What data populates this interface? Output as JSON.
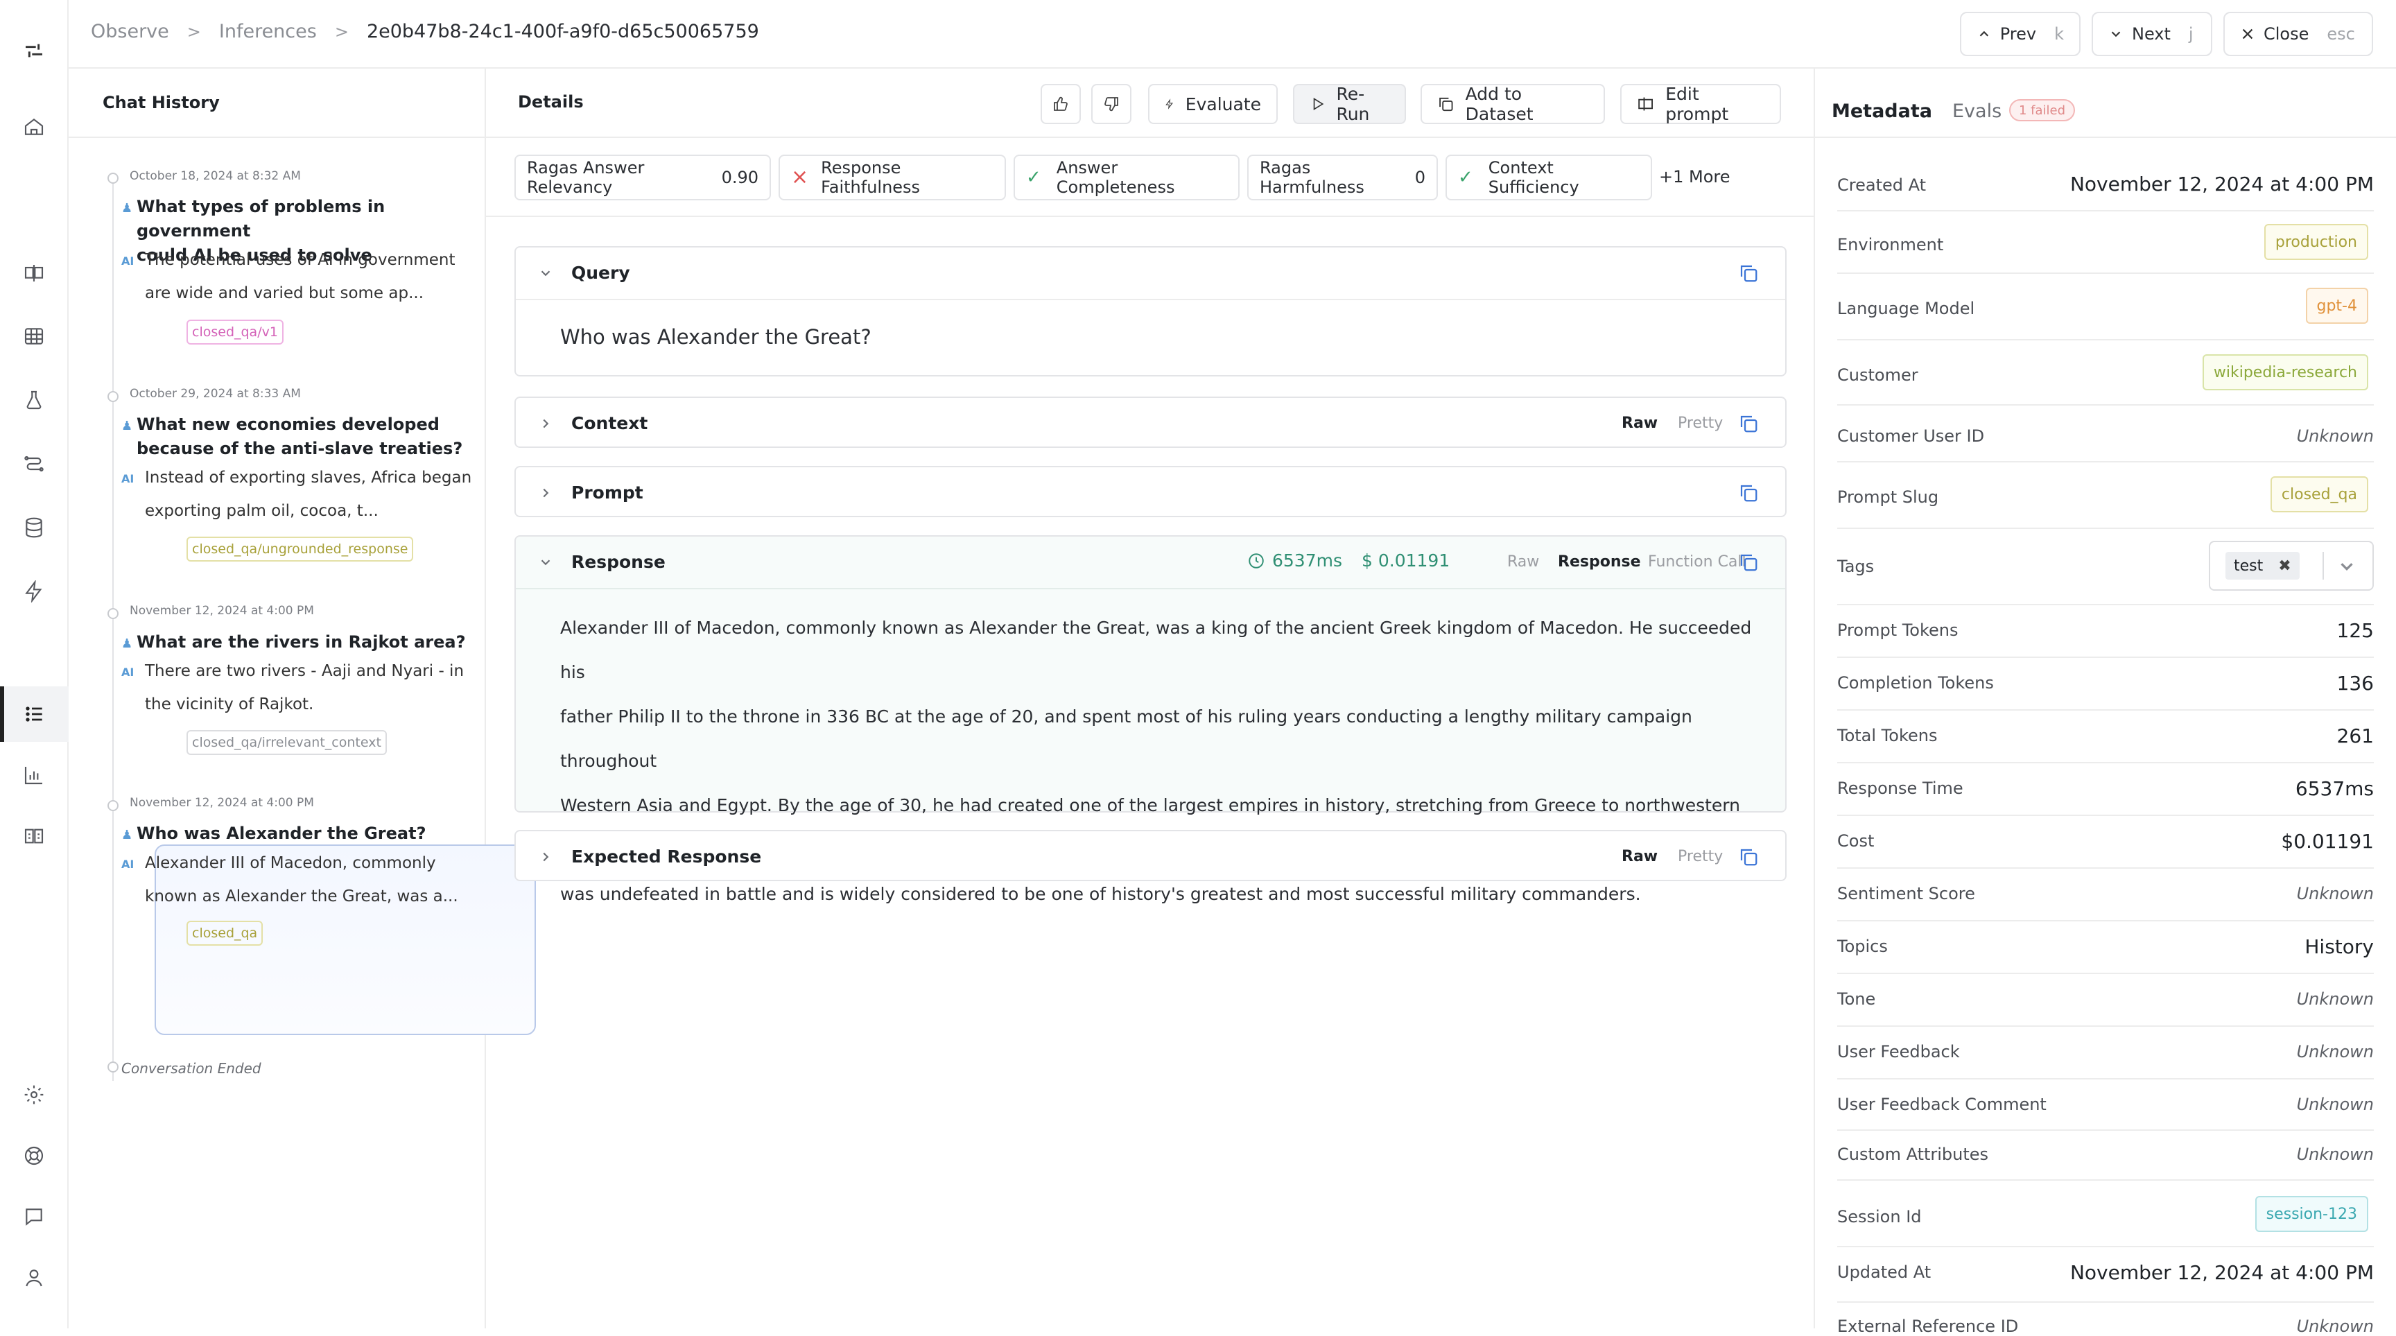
{
  "breadcrumb": [
    "Observe",
    "Inferences",
    "2e0b47b8-24c1-400f-a9f0-d65c50065759"
  ],
  "nav": {
    "prev_label": "Prev",
    "prev_key": "k",
    "next_label": "Next",
    "next_key": "j",
    "close_label": "Close",
    "close_key": "esc"
  },
  "chat": {
    "title": "Chat History",
    "messages": [
      {
        "date": "October 18, 2024 at 8:32 AM",
        "question_lines": [
          "What types of problems in government",
          "could AI be used to solve"
        ],
        "answer_lines": [
          "The potential uses of AI in government",
          "are wide and varied but some ap..."
        ],
        "tag": "closed_qa/v1"
      },
      {
        "date": "October 29, 2024 at 8:33 AM",
        "question_lines": [
          "What new economies developed",
          "because of the anti-slave treaties?"
        ],
        "answer_lines": [
          "Instead of exporting slaves, Africa began",
          "exporting palm oil, cocoa, t..."
        ],
        "tag": "closed_qa/ungrounded_response"
      },
      {
        "date": "November 12, 2024 at 4:00 PM",
        "question_lines": [
          "What are the rivers in Rajkot area?"
        ],
        "answer_lines": [
          "There are two rivers - Aaji and Nyari - in",
          "the vicinity of Rajkot."
        ],
        "tag": "closed_qa/irrelevant_context"
      },
      {
        "date": "November 12, 2024 at 4:00 PM",
        "question_lines": [
          "Who was Alexander the Great?"
        ],
        "answer_lines": [
          "Alexander III of Macedon, commonly",
          "known as Alexander the Great, was a..."
        ],
        "tag": "closed_qa"
      }
    ],
    "user_icon": "user-icon",
    "ai_label": "AI",
    "end_text": "Conversation Ended"
  },
  "details": {
    "title": "Details",
    "buttons": {
      "evaluate": "Evaluate",
      "rerun": "Re-Run",
      "add_dataset": "Add to Dataset",
      "edit_prompt": "Edit prompt"
    },
    "evals": [
      {
        "name": "Ragas Answer Relevancy",
        "value": "0.90"
      },
      {
        "name": "Response Faithfulness",
        "status": "fail"
      },
      {
        "name": "Answer Completeness",
        "status": "pass"
      },
      {
        "name": "Ragas Harmfulness",
        "value": "0"
      },
      {
        "name": "Context Sufficiency",
        "status": "pass"
      }
    ],
    "evals_more": "+1 More",
    "query": {
      "title": "Query",
      "text": "Who was Alexander the Great?"
    },
    "context": {
      "title": "Context",
      "opt_raw": "Raw",
      "opt_pretty": "Pretty"
    },
    "prompt": {
      "title": "Prompt"
    },
    "response": {
      "title": "Response",
      "time": "6537ms",
      "cost": "$ 0.01191",
      "opt_raw": "Raw",
      "opt_response": "Response",
      "opt_function": "Function Call",
      "lines": [
        "Alexander III of Macedon, commonly known as Alexander the Great, was a king of the ancient Greek kingdom of Macedon. He succeeded his",
        "father Philip II to the throne in 336 BC at the age of 20, and spent most of his ruling years conducting a lengthy military campaign throughout",
        "Western Asia and Egypt. By the age of 30, he had created one of the largest empires in history, stretching from Greece to northwestern India. He",
        "was undefeated in battle and is widely considered to be one of history's greatest and most successful military commanders."
      ]
    },
    "expected": {
      "title": "Expected Response",
      "opt_raw": "Raw",
      "opt_pretty": "Pretty"
    }
  },
  "meta": {
    "tab_metadata": "Metadata",
    "tab_evals": "Evals",
    "evals_badge": "1 failed",
    "rows": {
      "created_at": {
        "label": "Created At",
        "value": "November 12, 2024 at 4:00 PM"
      },
      "environment": {
        "label": "Environment",
        "value": "production"
      },
      "language_model": {
        "label": "Language Model",
        "value": "gpt-4"
      },
      "customer": {
        "label": "Customer",
        "value": "wikipedia-research"
      },
      "customer_user_id": {
        "label": "Customer User ID",
        "value": "Unknown"
      },
      "prompt_slug": {
        "label": "Prompt Slug",
        "value": "closed_qa"
      },
      "tags": {
        "label": "Tags",
        "value": "test"
      },
      "prompt_tokens": {
        "label": "Prompt Tokens",
        "value": "125"
      },
      "completion_tokens": {
        "label": "Completion Tokens",
        "value": "136"
      },
      "total_tokens": {
        "label": "Total Tokens",
        "value": "261"
      },
      "response_time": {
        "label": "Response Time",
        "value": "6537ms"
      },
      "cost": {
        "label": "Cost",
        "value": "$0.01191"
      },
      "sentiment": {
        "label": "Sentiment Score",
        "value": "Unknown"
      },
      "topics": {
        "label": "Topics",
        "value": "History"
      },
      "tone": {
        "label": "Tone",
        "value": "Unknown"
      },
      "user_feedback": {
        "label": "User Feedback",
        "value": "Unknown"
      },
      "user_feedback_comment": {
        "label": "User Feedback Comment",
        "value": "Unknown"
      },
      "custom_attributes": {
        "label": "Custom Attributes",
        "value": "Unknown"
      },
      "session_id": {
        "label": "Session Id",
        "value": "session-123"
      },
      "updated_at": {
        "label": "Updated At",
        "value": "November 12, 2024 at 4:00 PM"
      },
      "external_ref": {
        "label": "External Reference ID",
        "value": "Unknown"
      }
    }
  },
  "colors": {
    "accent_blue": "#3b74d6",
    "success": "#3aa36b",
    "error": "#e05252",
    "tag_pink": "#d462b8",
    "tag_olive": "#a8a13a",
    "tag_orange": "#e0913a",
    "tag_teal": "#3aa8b0"
  }
}
